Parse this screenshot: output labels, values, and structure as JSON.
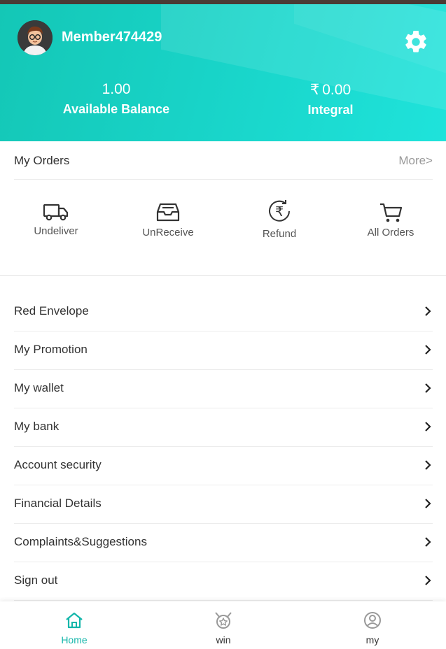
{
  "header": {
    "username": "Member474429",
    "balance": {
      "value": "1.00",
      "label": "Available Balance"
    },
    "integral": {
      "currency": "₹",
      "value": "0.00",
      "label": "Integral"
    },
    "accent_color": "#18d3c7"
  },
  "orders": {
    "title": "My Orders",
    "more": "More>",
    "items": [
      {
        "label": "Undeliver",
        "icon": "truck-icon"
      },
      {
        "label": "UnReceive",
        "icon": "inbox-icon"
      },
      {
        "label": "Refund",
        "icon": "rupee-refund-icon"
      },
      {
        "label": "All Orders",
        "icon": "cart-icon"
      }
    ]
  },
  "menu": [
    {
      "label": "Red Envelope"
    },
    {
      "label": "My Promotion"
    },
    {
      "label": "My wallet"
    },
    {
      "label": "My bank"
    },
    {
      "label": "Account security"
    },
    {
      "label": "Financial Details"
    },
    {
      "label": "Complaints&Suggestions"
    },
    {
      "label": "Sign out"
    }
  ],
  "tabbar": {
    "tabs": [
      {
        "label": "Home",
        "icon": "home-icon",
        "active": true
      },
      {
        "label": "win",
        "icon": "trophy-icon",
        "active": false
      },
      {
        "label": "my",
        "icon": "user-icon",
        "active": false
      }
    ],
    "active_color": "#13b6aa"
  }
}
